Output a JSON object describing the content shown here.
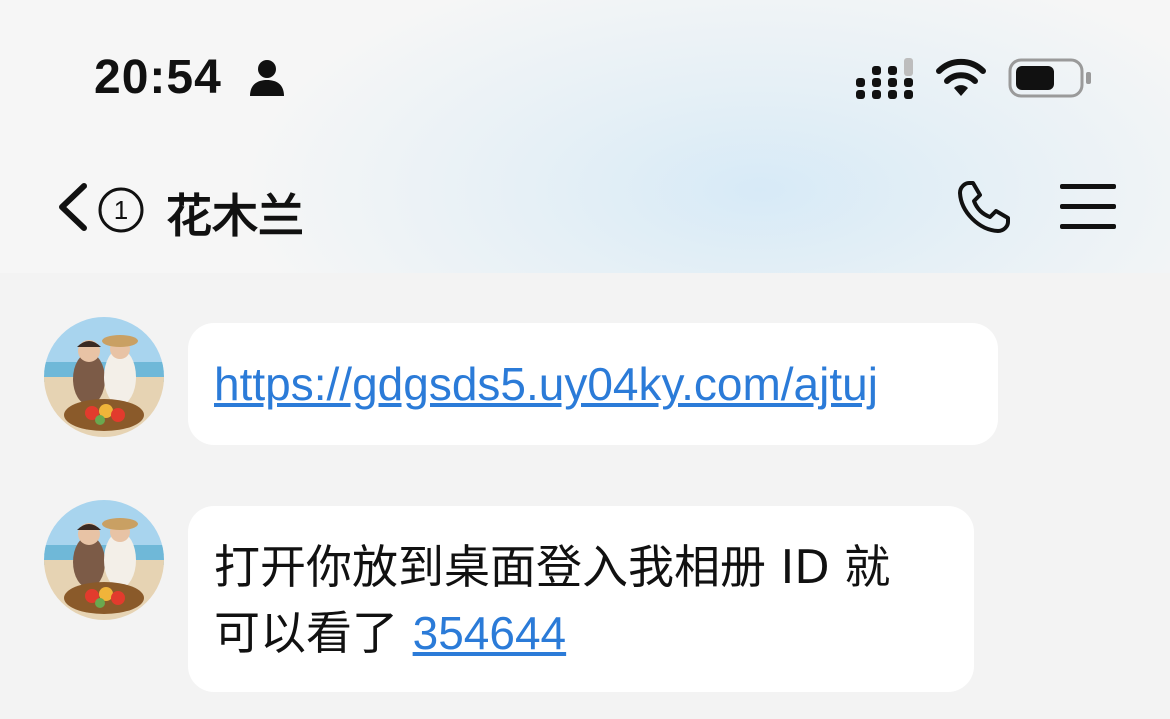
{
  "status_bar": {
    "time": "20:54",
    "icons": [
      "person-icon",
      "signal-icon",
      "wifi-icon",
      "battery-icon"
    ],
    "battery_level": 0.6
  },
  "header": {
    "unread_badge": "①",
    "contact_name": "花木兰",
    "icons": [
      "back-chevron-icon",
      "phone-icon",
      "menu-icon"
    ]
  },
  "messages": [
    {
      "type": "link",
      "text": "https://gdgsds5.uy04ky.com/ajtuj"
    },
    {
      "type": "text",
      "line1": "打开你放到桌面登入我相册 ID 就",
      "line2_prefix": "可以看了 ",
      "code": "354644"
    }
  ],
  "colors": {
    "link": "#2b7bd8",
    "bubble": "#ffffff",
    "background": "#f3f3f3",
    "header_tint": "#d7eaf7"
  }
}
